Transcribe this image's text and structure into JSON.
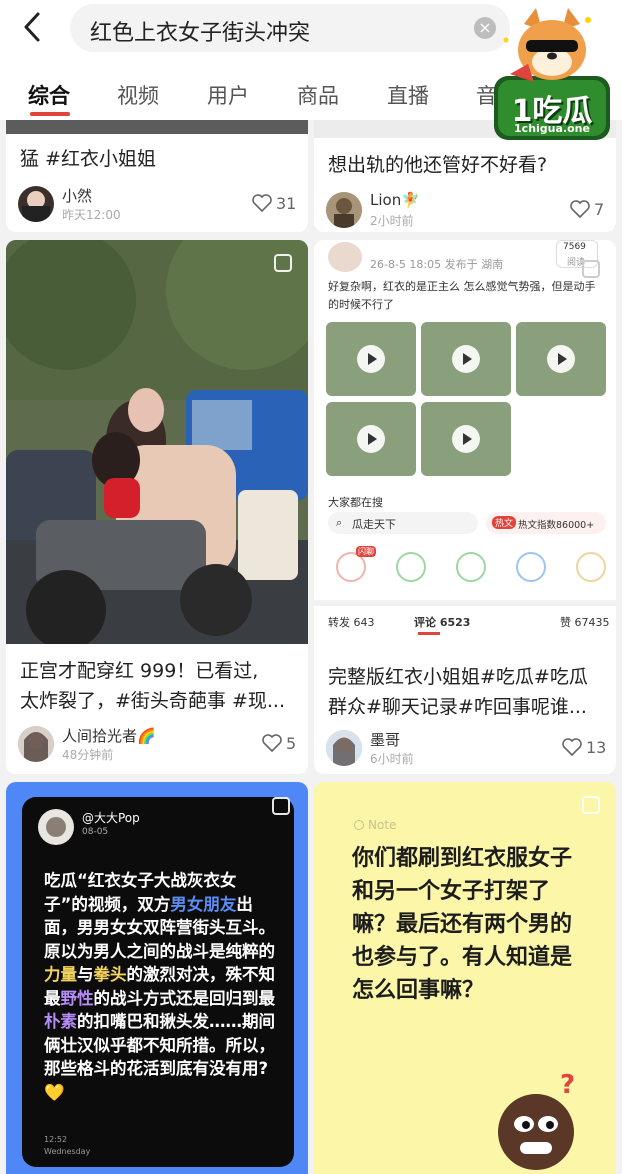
{
  "search": {
    "query": "红色上衣女子街头冲突",
    "clear_symbol": "×"
  },
  "tabs": [
    {
      "label": "综合",
      "active": true
    },
    {
      "label": "视频",
      "active": false
    },
    {
      "label": "用户",
      "active": false
    },
    {
      "label": "商品",
      "active": false
    },
    {
      "label": "直播",
      "active": false
    },
    {
      "label": "音",
      "active": false
    }
  ],
  "logo": {
    "brand": "1吃瓜",
    "url": "1chigua.one"
  },
  "colors": {
    "accent": "#e0443c",
    "blue_card": "#4f88f6",
    "yellow_card": "#fbf6a8"
  },
  "cards": {
    "top_left": {
      "title": "猛 #红衣小姐姐",
      "author": "小然",
      "time": "昨天12:00",
      "likes": "31"
    },
    "top_right": {
      "title": "想出轨的他还管好不好看?",
      "author": "Lion🧚",
      "time": "2小时前",
      "likes": "7"
    },
    "mid_left": {
      "title_line1": "正宫才配穿红 999！已看过,",
      "title_line2": "太炸裂了，#街头奇葩事 #现...",
      "author": "人间拾光者🌈",
      "time": "48分钟前",
      "likes": "5"
    },
    "mid_right": {
      "post_meta": "26-8-5 18:05 发布于 湖南",
      "post_text": "好复杂啊，红衣的是正主么 怎么感觉气势强，但是动手的时候不行了",
      "views": "7569",
      "views_label": "阅读",
      "hot_search_label": "大家都在搜",
      "hot_search_query": "瓜走天下",
      "hot_search_tag": "热文",
      "hot_index": "热文指数86000+",
      "hot_badge": "闪聊",
      "repost": "转发 643",
      "comment": "评论 6523",
      "praise": "赞 67435",
      "title_line1": "完整版红衣小姐姐#吃瓜#吃瓜",
      "title_line2": "群众#聊天记录#咋回事呢谁...",
      "author": "墨哥",
      "time": "6小时前",
      "likes": "13"
    },
    "bottom_left": {
      "handle": "@大大Pop",
      "date": "08-05",
      "p1": "吃瓜“红衣女子大战灰衣女子”的视频，双方",
      "p1_hl": "男女朋友",
      "p2": "出面，男男女女双阵营街头互斗。原以为男人之间的战斗是纯粹的",
      "p2_hl1": "力量",
      "p2_mid": "与",
      "p2_hl2": "拳头",
      "p3": "的激烈对决，殊不知最",
      "p3_hl": "野性",
      "p4": "的战斗方式还是回归到最",
      "p4_hl": "朴素",
      "p5": "的扣嘴巴和揪头发……期间俩壮汉似乎都不知所措。所以，那些格斗的花活到底有没有用?",
      "emoji": "💛",
      "footer_time": "12:52",
      "footer_day": "Wednesday"
    },
    "bottom_right": {
      "note_label": "Note",
      "text": "你们都刷到红衣服女子和另一个女子打架了嘛？最后还有两个男的也参与了。有人知道是怎么回事嘛？",
      "question_mark": "?"
    }
  }
}
